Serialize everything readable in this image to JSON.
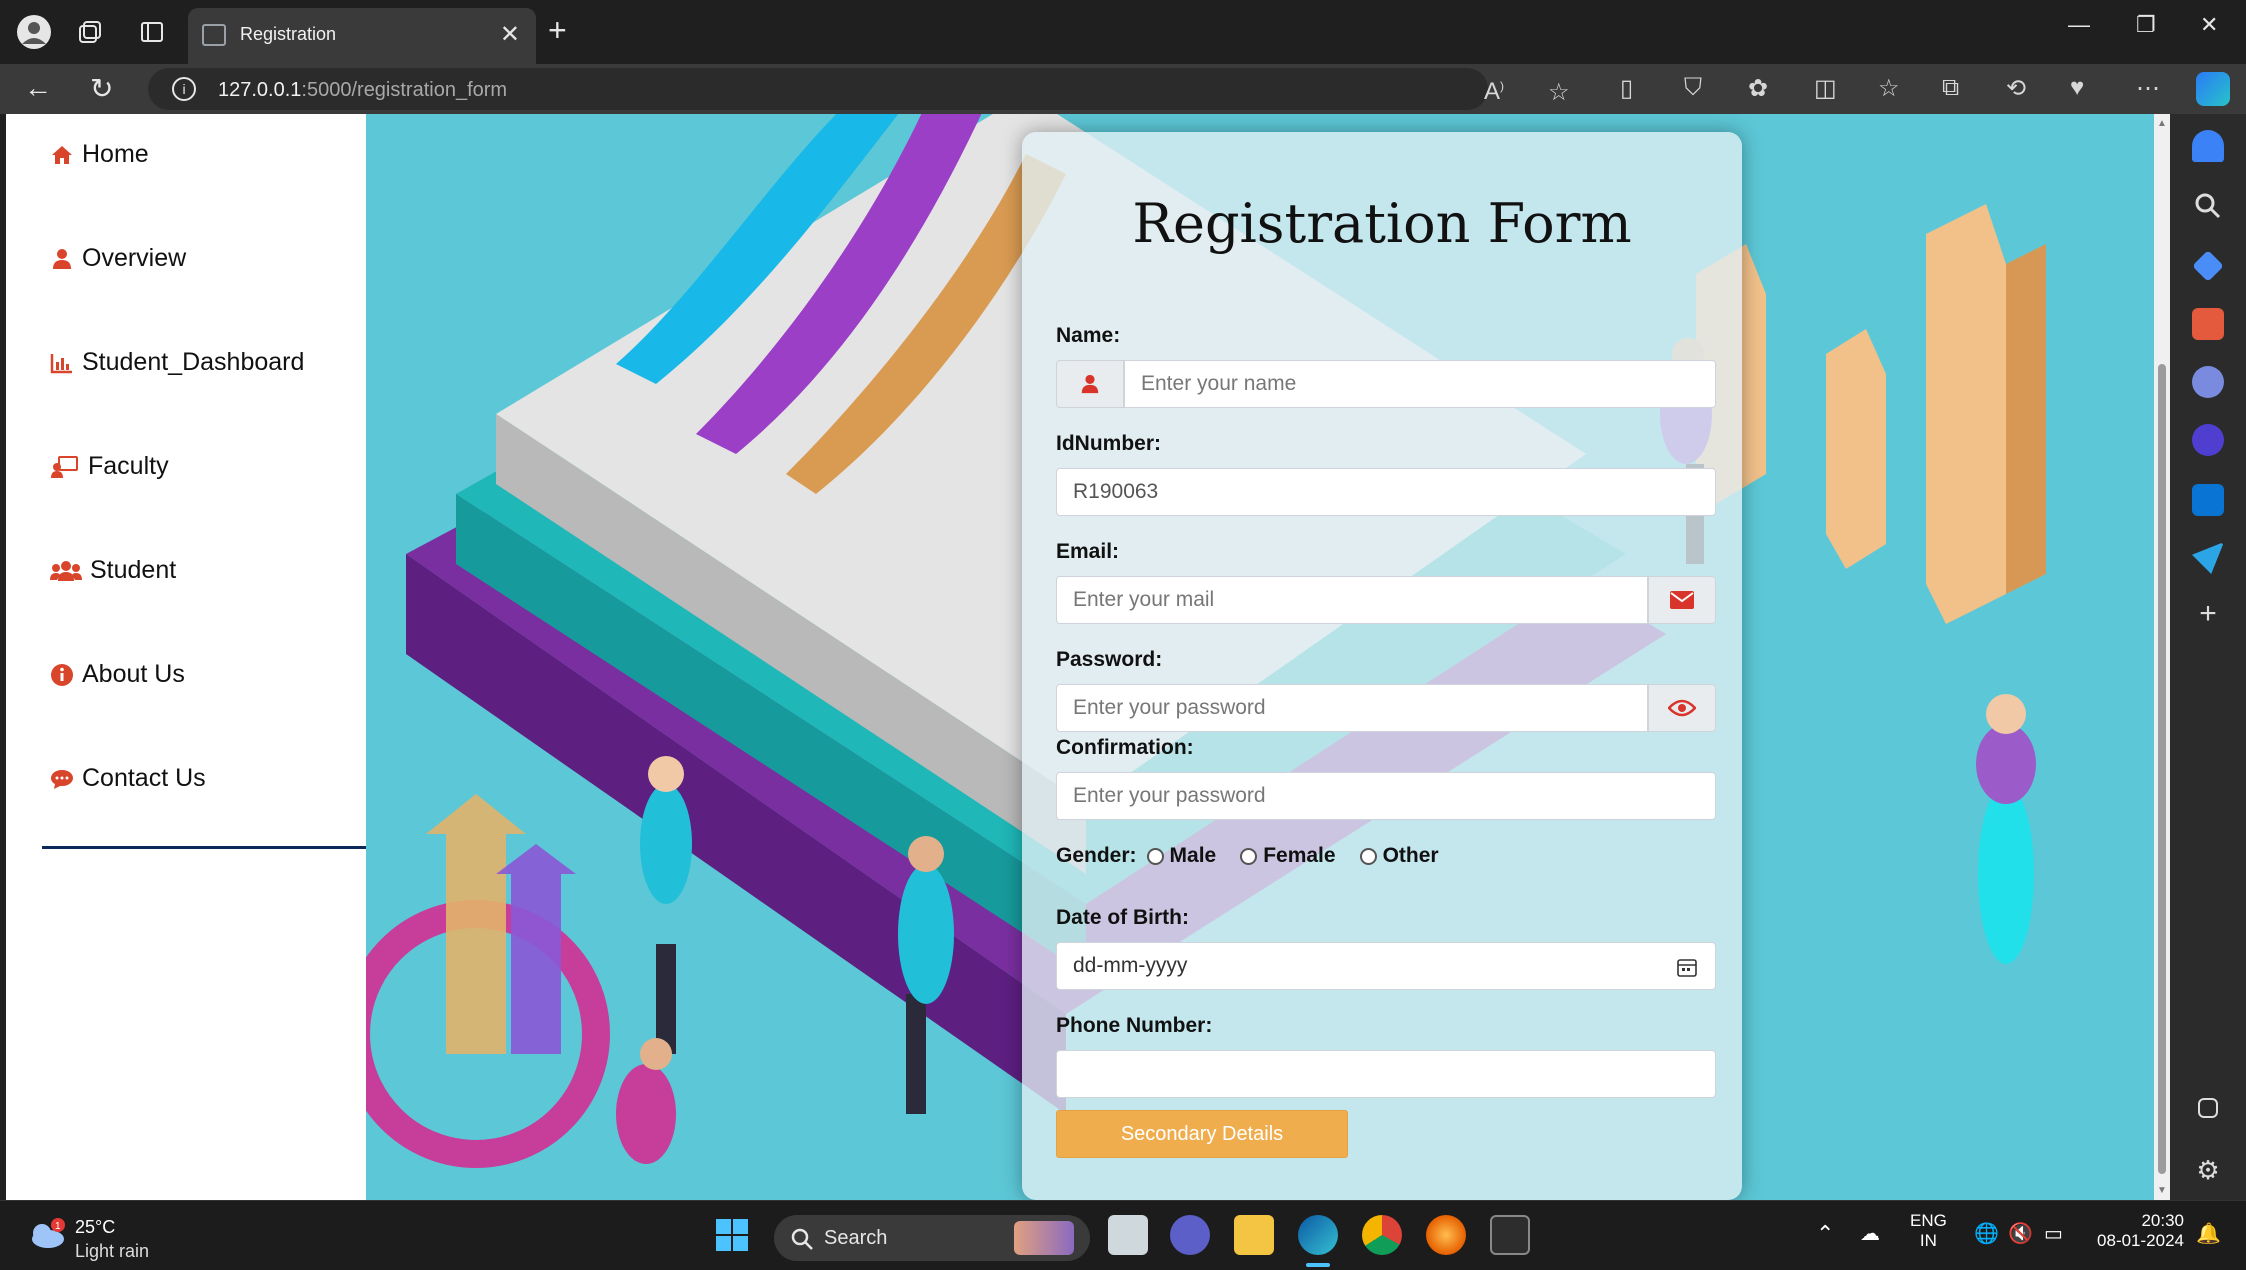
{
  "browser": {
    "tab_title": "Registration",
    "url_host": "127.0.0.1",
    "url_path": ":5000/registration_form"
  },
  "sidebar": {
    "items": [
      {
        "label": "Home",
        "icon": "home-icon"
      },
      {
        "label": "Overview",
        "icon": "user-icon"
      },
      {
        "label": "Student_Dashboard",
        "icon": "bar-chart-icon"
      },
      {
        "label": "Faculty",
        "icon": "teacher-icon"
      },
      {
        "label": "Student",
        "icon": "users-icon"
      },
      {
        "label": "About Us",
        "icon": "info-icon"
      },
      {
        "label": "Contact Us",
        "icon": "comment-icon"
      }
    ],
    "accent_color": "#d9452b"
  },
  "form": {
    "title": "Registration Form",
    "name_label": "Name:",
    "name_placeholder": "Enter your name",
    "id_label": "IdNumber:",
    "id_value": "R190063",
    "email_label": "Email:",
    "email_placeholder": "Enter your mail",
    "password_label": "Password:",
    "password_placeholder": "Enter your password",
    "confirm_label": "Confirmation:",
    "confirm_placeholder": "Enter your password",
    "gender_label": "Gender:",
    "gender_options": [
      "Male",
      "Female",
      "Other"
    ],
    "dob_label": "Date of Birth:",
    "dob_placeholder": "dd-mm-yyyy",
    "phone_label": "Phone Number:",
    "phone_value": "",
    "submit_label": "Secondary Details",
    "button_color": "#f0ad4e"
  },
  "taskbar": {
    "temperature": "25°C",
    "weather": "Light rain",
    "search_label": "Search",
    "lang_top": "ENG",
    "lang_bottom": "IN",
    "time": "20:30",
    "date": "08-01-2024"
  }
}
